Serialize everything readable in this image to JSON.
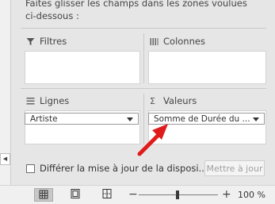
{
  "instructions": {
    "line1": "Faites glisser les champs dans les zones voulues",
    "line2": "ci-dessous :"
  },
  "zones": {
    "filters": {
      "label": "Filtres",
      "icon": "filter-icon"
    },
    "columns": {
      "label": "Colonnes",
      "icon": "columns-icon"
    },
    "rows": {
      "label": "Lignes",
      "icon": "rows-icon",
      "field": "Artiste"
    },
    "values": {
      "label": "Valeurs",
      "icon": "sigma-icon",
      "field": "Somme de Durée du ..."
    }
  },
  "defer": {
    "label": "Différer la mise à jour de la disposi..."
  },
  "update_button": {
    "label": "Mettre à jour"
  },
  "statusbar": {
    "zoom_minus": "−",
    "zoom_plus": "+",
    "zoom_level": "100 %",
    "zoom_fraction": 0.5
  },
  "colors": {
    "arrow": "#e01b1b"
  }
}
